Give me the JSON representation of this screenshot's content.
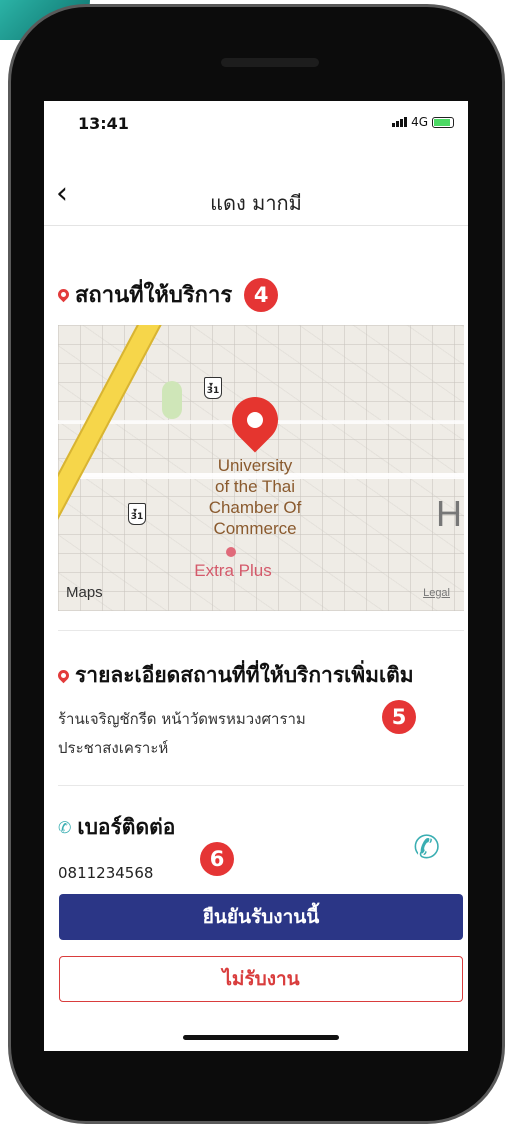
{
  "status_bar": {
    "time": "13:41",
    "network": "4G"
  },
  "nav": {
    "title": "แดง มากมี"
  },
  "service_location": {
    "heading": "สถานที่ให้บริการ",
    "badge": "4"
  },
  "map": {
    "place_name_lines": [
      "University",
      "of the Thai",
      "Chamber Of",
      "Commerce"
    ],
    "poi_label": "Extra Plus",
    "route_shield_1": "31",
    "route_shield_2": "31",
    "edge_letter": "H",
    "maps_logo": "Maps",
    "legal": "Legal"
  },
  "location_details": {
    "heading": "รายละเอียดสถานที่ที่ให้บริการเพิ่มเติม",
    "badge": "5",
    "text_line1": "ร้านเจริญชักรีด หน้าวัดพรหมวงศาราม",
    "text_line2": "ประชาสงเคราะห์"
  },
  "contact": {
    "heading": "เบอร์ติดต่อ",
    "badge": "6",
    "phone": "0811234568"
  },
  "actions": {
    "confirm_label": "ยืนยันรับงานนี้",
    "reject_label": "ไม่รับงาน"
  },
  "colors": {
    "primary": "#2b3686",
    "danger": "#d93d3d",
    "accent": "#3aaeb2",
    "badge": "#e53535"
  }
}
